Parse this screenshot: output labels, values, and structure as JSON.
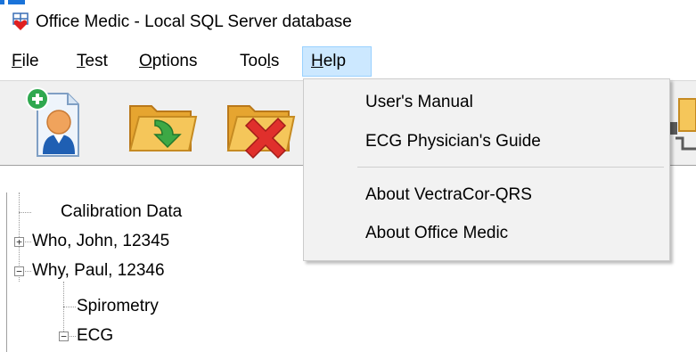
{
  "window": {
    "title": "Office Medic - Local SQL Server database",
    "icon": "app-medic-icon"
  },
  "menubar": {
    "items": [
      {
        "label": "File",
        "mnemonic": "F",
        "rest": "ile"
      },
      {
        "label": "Test",
        "mnemonic": "T",
        "rest": "est"
      },
      {
        "label": "Options",
        "mnemonic": "O",
        "rest": "ptions"
      },
      {
        "label": "Tools",
        "pre": "Too",
        "mnemonic": "l",
        "rest": "s"
      },
      {
        "label": "Help",
        "mnemonic": "H",
        "rest": "elp",
        "active": true
      }
    ]
  },
  "toolbar": {
    "buttons": [
      {
        "icon": "new-patient-icon"
      },
      {
        "icon": "open-folder-icon"
      },
      {
        "icon": "delete-folder-icon"
      },
      {
        "icon": "export-icon"
      }
    ]
  },
  "help_menu": {
    "items": [
      {
        "label": "User's Manual"
      },
      {
        "label": "ECG Physician's Guide"
      },
      {
        "label": "About VectraCor-QRS"
      },
      {
        "label": "About Office Medic"
      }
    ]
  },
  "tree": {
    "nodes": [
      {
        "label": "Calibration Data",
        "level": 0,
        "expander": ""
      },
      {
        "label": "Who, John, 12345",
        "level": 0,
        "expander": "+"
      },
      {
        "label": "Why, Paul, 12346",
        "level": 0,
        "expander": "−"
      },
      {
        "label": "Spirometry",
        "level": 1,
        "expander": ""
      },
      {
        "label": "ECG",
        "level": 1,
        "expander": "−"
      }
    ]
  },
  "colors": {
    "menu_highlight": "#cce8ff",
    "menu_highlight_border": "#99d1ff",
    "dropdown_bg": "#f2f2f2",
    "toolbar_bg": "#f0f0f0",
    "accent_blue": "#1a73d9"
  }
}
